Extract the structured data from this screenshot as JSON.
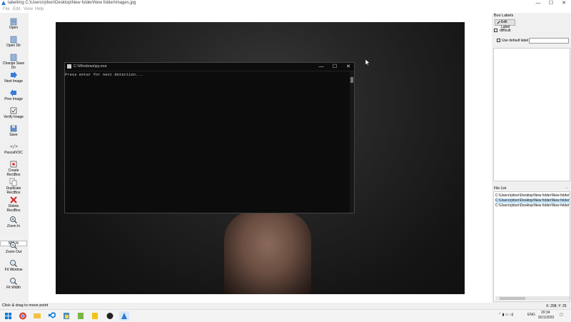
{
  "window": {
    "title": "labelImg C:\\Users\\rjrbxn\\Desktop\\New folder\\New folder\\images.jpg",
    "controls": [
      "—",
      "☐",
      "✕"
    ]
  },
  "menu": [
    "File",
    "Edit",
    "View",
    "Help"
  ],
  "toolbar": [
    {
      "label": "Open",
      "icon": "open-icon"
    },
    {
      "label": "Open Dir",
      "icon": "open-dir-icon"
    },
    {
      "label": "Change Save Dir",
      "icon": "change-save-dir-icon"
    },
    {
      "label": "Next Image",
      "icon": "next-image-icon"
    },
    {
      "label": "Prev Image",
      "icon": "prev-image-icon"
    },
    {
      "label": "Verify Image",
      "icon": "verify-icon"
    },
    {
      "label": "Save",
      "icon": "save-icon"
    },
    {
      "label": "PascalVOC",
      "icon": "format-icon"
    },
    {
      "label": "Create\nRectBox",
      "icon": "create-rect-icon"
    },
    {
      "label": "Duplicate\nRectBox",
      "icon": "duplicate-rect-icon"
    },
    {
      "label": "Delete\nRectBox",
      "icon": "delete-rect-icon"
    },
    {
      "label": "Zoom In",
      "icon": "zoom-in-icon"
    },
    {
      "label": "Zoom Out",
      "icon": "zoom-out-icon"
    },
    {
      "label": "Fit Window",
      "icon": "fit-window-icon"
    },
    {
      "label": "Fit Width",
      "icon": "fit-width-icon"
    }
  ],
  "zoom_value": "500 %",
  "console": {
    "title": "C:\\Windows\\py.exe",
    "text": "Press enter for next detection...",
    "controls": [
      "—",
      "☐",
      "✕"
    ]
  },
  "box_labels": {
    "header": "Box Labels",
    "edit_label": "Edit Label",
    "difficult": "difficult",
    "use_default_label": "Use default label"
  },
  "file_list": {
    "header": "File List",
    "items": [
      "C:\\Users\\rjrbxn\\Desktop\\New folder\\New folder\\1.jpg",
      "C:\\Users\\rjrbxn\\Desktop\\New folder\\New folder\\images.jpg",
      "C:\\Users\\rjrbxn\\Desktop\\New folder\\New folder\\3.jpg"
    ],
    "selected_index": 1
  },
  "status": {
    "message": "Click & drag to move point",
    "coords": "X: 208; Y: 25"
  },
  "taskbar": {
    "lang": "ENG",
    "time": "20:34",
    "date": "9/21/2020"
  },
  "colors": {
    "accent": "#0078d7",
    "selected": "#cce8ff",
    "console_bg": "#0c0c0c"
  }
}
